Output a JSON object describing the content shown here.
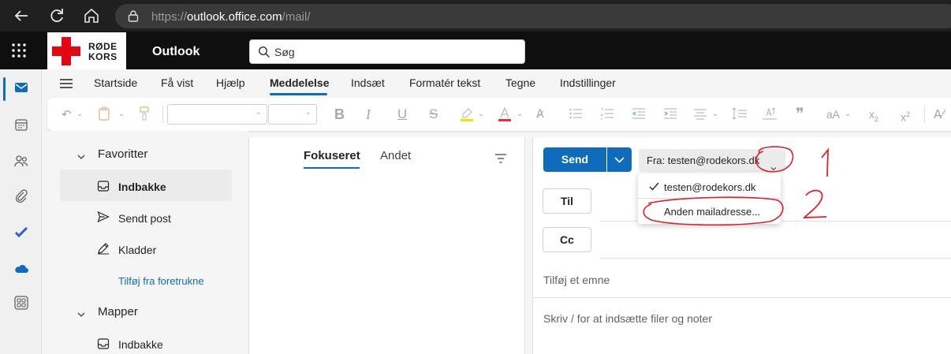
{
  "browser": {
    "url_base": "https://",
    "url_host": "outlook.office.com",
    "url_path": "/mail/"
  },
  "suite": {
    "logo_line1": "RØDE",
    "logo_line2": "KORS",
    "app_title": "Outlook",
    "search_placeholder": "Søg"
  },
  "tabs": [
    "Startside",
    "Få vist",
    "Hjælp",
    "Meddelelse",
    "Indsæt",
    "Formatér tekst",
    "Tegne",
    "Indstillinger"
  ],
  "folders": {
    "favorites": "Favoritter",
    "inbox": "Indbakke",
    "sent": "Sendt post",
    "drafts": "Kladder",
    "add_favorite": "Tilføj fra foretrukne",
    "folders_head": "Mapper",
    "inbox2": "Indbakke"
  },
  "message_list": {
    "focused": "Fokuseret",
    "other": "Andet"
  },
  "compose": {
    "send": "Send",
    "from": "Fra: testen@rodekors.dk",
    "to": "Til",
    "cc": "Cc",
    "subject_placeholder": "Tilføj et emne",
    "body_placeholder": "Skriv / for at indsætte filer og noter"
  },
  "from_dropdown": {
    "current": "testen@rodekors.dk",
    "other": "Anden mailadresse..."
  },
  "annotations": {
    "one": "1",
    "two": "2"
  },
  "colors": {
    "accent": "#0f6cbd",
    "brand_red": "#e30613",
    "annotation_red": "#e0202a"
  }
}
